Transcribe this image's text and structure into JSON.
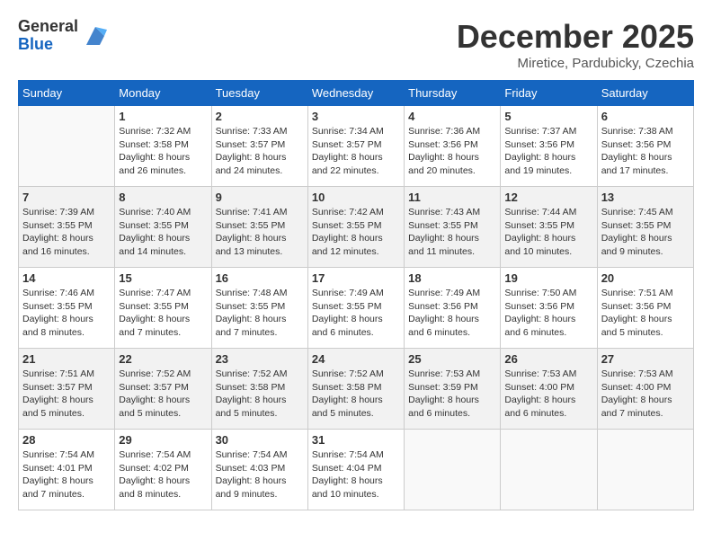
{
  "logo": {
    "general": "General",
    "blue": "Blue"
  },
  "header": {
    "month": "December 2025",
    "location": "Miretice, Pardubicky, Czechia"
  },
  "columns": [
    "Sunday",
    "Monday",
    "Tuesday",
    "Wednesday",
    "Thursday",
    "Friday",
    "Saturday"
  ],
  "weeks": [
    {
      "shaded": false,
      "days": [
        {
          "num": "",
          "info": ""
        },
        {
          "num": "1",
          "info": "Sunrise: 7:32 AM\nSunset: 3:58 PM\nDaylight: 8 hours\nand 26 minutes."
        },
        {
          "num": "2",
          "info": "Sunrise: 7:33 AM\nSunset: 3:57 PM\nDaylight: 8 hours\nand 24 minutes."
        },
        {
          "num": "3",
          "info": "Sunrise: 7:34 AM\nSunset: 3:57 PM\nDaylight: 8 hours\nand 22 minutes."
        },
        {
          "num": "4",
          "info": "Sunrise: 7:36 AM\nSunset: 3:56 PM\nDaylight: 8 hours\nand 20 minutes."
        },
        {
          "num": "5",
          "info": "Sunrise: 7:37 AM\nSunset: 3:56 PM\nDaylight: 8 hours\nand 19 minutes."
        },
        {
          "num": "6",
          "info": "Sunrise: 7:38 AM\nSunset: 3:56 PM\nDaylight: 8 hours\nand 17 minutes."
        }
      ]
    },
    {
      "shaded": true,
      "days": [
        {
          "num": "7",
          "info": "Sunrise: 7:39 AM\nSunset: 3:55 PM\nDaylight: 8 hours\nand 16 minutes."
        },
        {
          "num": "8",
          "info": "Sunrise: 7:40 AM\nSunset: 3:55 PM\nDaylight: 8 hours\nand 14 minutes."
        },
        {
          "num": "9",
          "info": "Sunrise: 7:41 AM\nSunset: 3:55 PM\nDaylight: 8 hours\nand 13 minutes."
        },
        {
          "num": "10",
          "info": "Sunrise: 7:42 AM\nSunset: 3:55 PM\nDaylight: 8 hours\nand 12 minutes."
        },
        {
          "num": "11",
          "info": "Sunrise: 7:43 AM\nSunset: 3:55 PM\nDaylight: 8 hours\nand 11 minutes."
        },
        {
          "num": "12",
          "info": "Sunrise: 7:44 AM\nSunset: 3:55 PM\nDaylight: 8 hours\nand 10 minutes."
        },
        {
          "num": "13",
          "info": "Sunrise: 7:45 AM\nSunset: 3:55 PM\nDaylight: 8 hours\nand 9 minutes."
        }
      ]
    },
    {
      "shaded": false,
      "days": [
        {
          "num": "14",
          "info": "Sunrise: 7:46 AM\nSunset: 3:55 PM\nDaylight: 8 hours\nand 8 minutes."
        },
        {
          "num": "15",
          "info": "Sunrise: 7:47 AM\nSunset: 3:55 PM\nDaylight: 8 hours\nand 7 minutes."
        },
        {
          "num": "16",
          "info": "Sunrise: 7:48 AM\nSunset: 3:55 PM\nDaylight: 8 hours\nand 7 minutes."
        },
        {
          "num": "17",
          "info": "Sunrise: 7:49 AM\nSunset: 3:55 PM\nDaylight: 8 hours\nand 6 minutes."
        },
        {
          "num": "18",
          "info": "Sunrise: 7:49 AM\nSunset: 3:56 PM\nDaylight: 8 hours\nand 6 minutes."
        },
        {
          "num": "19",
          "info": "Sunrise: 7:50 AM\nSunset: 3:56 PM\nDaylight: 8 hours\nand 6 minutes."
        },
        {
          "num": "20",
          "info": "Sunrise: 7:51 AM\nSunset: 3:56 PM\nDaylight: 8 hours\nand 5 minutes."
        }
      ]
    },
    {
      "shaded": true,
      "days": [
        {
          "num": "21",
          "info": "Sunrise: 7:51 AM\nSunset: 3:57 PM\nDaylight: 8 hours\nand 5 minutes."
        },
        {
          "num": "22",
          "info": "Sunrise: 7:52 AM\nSunset: 3:57 PM\nDaylight: 8 hours\nand 5 minutes."
        },
        {
          "num": "23",
          "info": "Sunrise: 7:52 AM\nSunset: 3:58 PM\nDaylight: 8 hours\nand 5 minutes."
        },
        {
          "num": "24",
          "info": "Sunrise: 7:52 AM\nSunset: 3:58 PM\nDaylight: 8 hours\nand 5 minutes."
        },
        {
          "num": "25",
          "info": "Sunrise: 7:53 AM\nSunset: 3:59 PM\nDaylight: 8 hours\nand 6 minutes."
        },
        {
          "num": "26",
          "info": "Sunrise: 7:53 AM\nSunset: 4:00 PM\nDaylight: 8 hours\nand 6 minutes."
        },
        {
          "num": "27",
          "info": "Sunrise: 7:53 AM\nSunset: 4:00 PM\nDaylight: 8 hours\nand 7 minutes."
        }
      ]
    },
    {
      "shaded": false,
      "days": [
        {
          "num": "28",
          "info": "Sunrise: 7:54 AM\nSunset: 4:01 PM\nDaylight: 8 hours\nand 7 minutes."
        },
        {
          "num": "29",
          "info": "Sunrise: 7:54 AM\nSunset: 4:02 PM\nDaylight: 8 hours\nand 8 minutes."
        },
        {
          "num": "30",
          "info": "Sunrise: 7:54 AM\nSunset: 4:03 PM\nDaylight: 8 hours\nand 9 minutes."
        },
        {
          "num": "31",
          "info": "Sunrise: 7:54 AM\nSunset: 4:04 PM\nDaylight: 8 hours\nand 10 minutes."
        },
        {
          "num": "",
          "info": ""
        },
        {
          "num": "",
          "info": ""
        },
        {
          "num": "",
          "info": ""
        }
      ]
    }
  ]
}
